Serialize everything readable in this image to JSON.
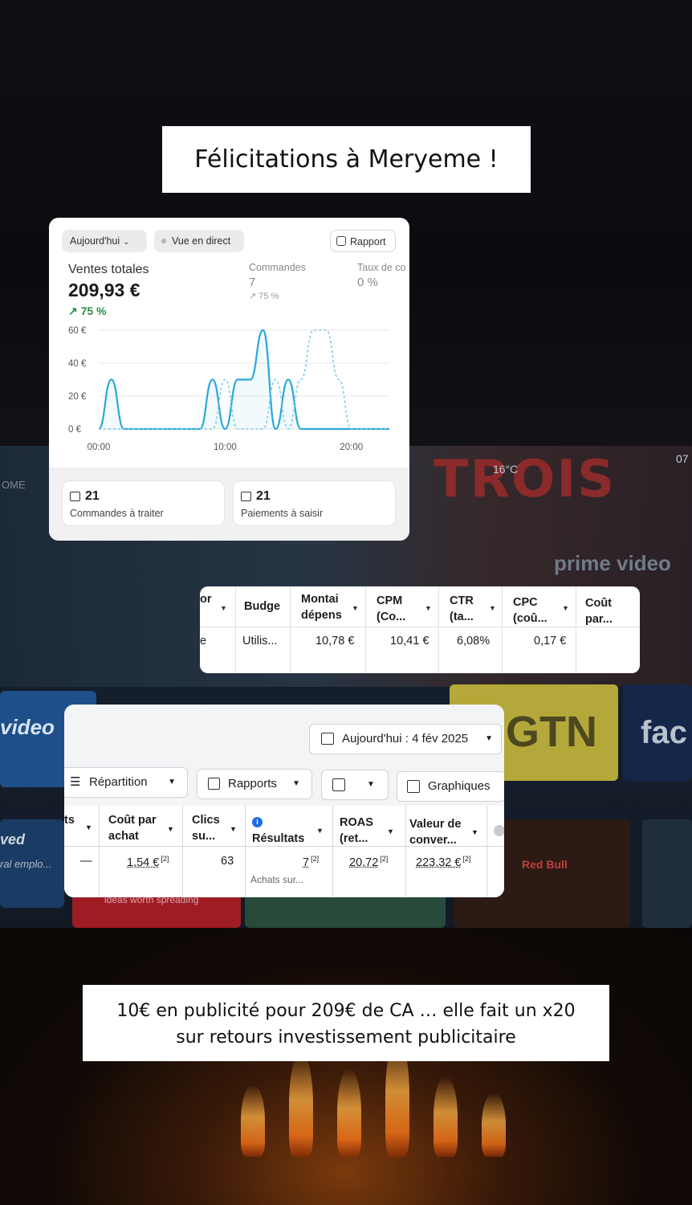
{
  "captions": {
    "top": "Félicitations à Meryeme !",
    "bottom_line1": "10€ en publicité pour 209€ de CA … elle fait un x20",
    "bottom_line2": "sur retours investissement publicitaire"
  },
  "background": {
    "show_title": "TROIS",
    "temperature": "16°C",
    "clock": "07",
    "left_label": "OME",
    "brand": "prime video",
    "tile_video": "video",
    "tile_gtn": "GTN",
    "tile_fac": "fac",
    "tile_ved": "ved",
    "tile_emplo": "ral emplo...",
    "tile_ideas": "ideas worth spreading",
    "tile_redbull": "Red Bull"
  },
  "shopify": {
    "date_filter": "Aujourd'hui",
    "live_button": "Vue en direct",
    "report_button": "Rapport",
    "total_sales_label": "Ventes totales",
    "total_sales_value": "209,93 €",
    "total_sales_trend": "↗ 75 %",
    "orders_label": "Commandes",
    "orders_value": "7",
    "orders_trend": "↗ 75 %",
    "conversion_label": "Taux de co",
    "conversion_value": "0 %",
    "orders_to_process_count": "21",
    "orders_to_process_label": "Commandes à traiter",
    "payments_count": "21",
    "payments_label": "Paiements à saisir"
  },
  "chart_data": {
    "type": "line",
    "x": [
      0,
      1,
      2,
      3,
      4,
      5,
      6,
      7,
      8,
      9,
      10,
      11,
      12,
      13,
      14,
      15,
      16,
      17,
      18,
      19,
      20,
      21,
      22,
      23
    ],
    "xticks": [
      "00:00",
      "10:00",
      "20:00"
    ],
    "yticks": [
      "60 €",
      "40 €",
      "20 €",
      "0 €"
    ],
    "ylim": [
      0,
      60
    ],
    "series": [
      {
        "style": "solid",
        "color": "#2aa8d8",
        "values": [
          0,
          30,
          0,
          0,
          0,
          0,
          0,
          0,
          0,
          30,
          0,
          30,
          30,
          60,
          0,
          30,
          0,
          0,
          0,
          0,
          0,
          0,
          0,
          0
        ]
      },
      {
        "style": "dashed",
        "color": "#7cc8e8",
        "values": [
          0,
          0,
          0,
          0,
          0,
          0,
          0,
          0,
          0,
          0,
          30,
          0,
          0,
          0,
          30,
          0,
          30,
          60,
          60,
          30,
          0,
          0,
          0,
          0
        ]
      }
    ]
  },
  "meta_row": {
    "headers": [
      {
        "line1": "or",
        "line2": ""
      },
      {
        "line1": "Budge",
        "line2": ""
      },
      {
        "line1": "Montai",
        "line2": "dépens"
      },
      {
        "line1": "CPM",
        "line2": "(Co..."
      },
      {
        "line1": "CTR",
        "line2": "(ta..."
      },
      {
        "line1": "CPC",
        "line2": "(coû..."
      },
      {
        "line1": "Coût",
        "line2": "par..."
      }
    ],
    "values": [
      "e",
      "Utilis...",
      "10,78 €",
      "10,41 €",
      "6,08%",
      "0,17 €",
      ""
    ]
  },
  "meta_table": {
    "date_button": "Aujourd'hui : 4 fév 2025",
    "breakdown_button": "Répartition",
    "reports_button": "Rapports",
    "charts_button": "Graphiques",
    "headers": [
      {
        "line1": "ts",
        "line2": ""
      },
      {
        "line1": "Coût par",
        "line2": "achat"
      },
      {
        "line1": "Clics",
        "line2": "su..."
      },
      {
        "line1": "Résultats",
        "line2": ""
      },
      {
        "line1": "ROAS",
        "line2": "(ret..."
      },
      {
        "line1": "Valeur de",
        "line2": "conver..."
      }
    ],
    "values": [
      "—",
      "1,54 €",
      "63",
      "7",
      "20,72",
      "223,32 €"
    ],
    "footnote": "[2]",
    "results_sub": "Achats sur..."
  }
}
